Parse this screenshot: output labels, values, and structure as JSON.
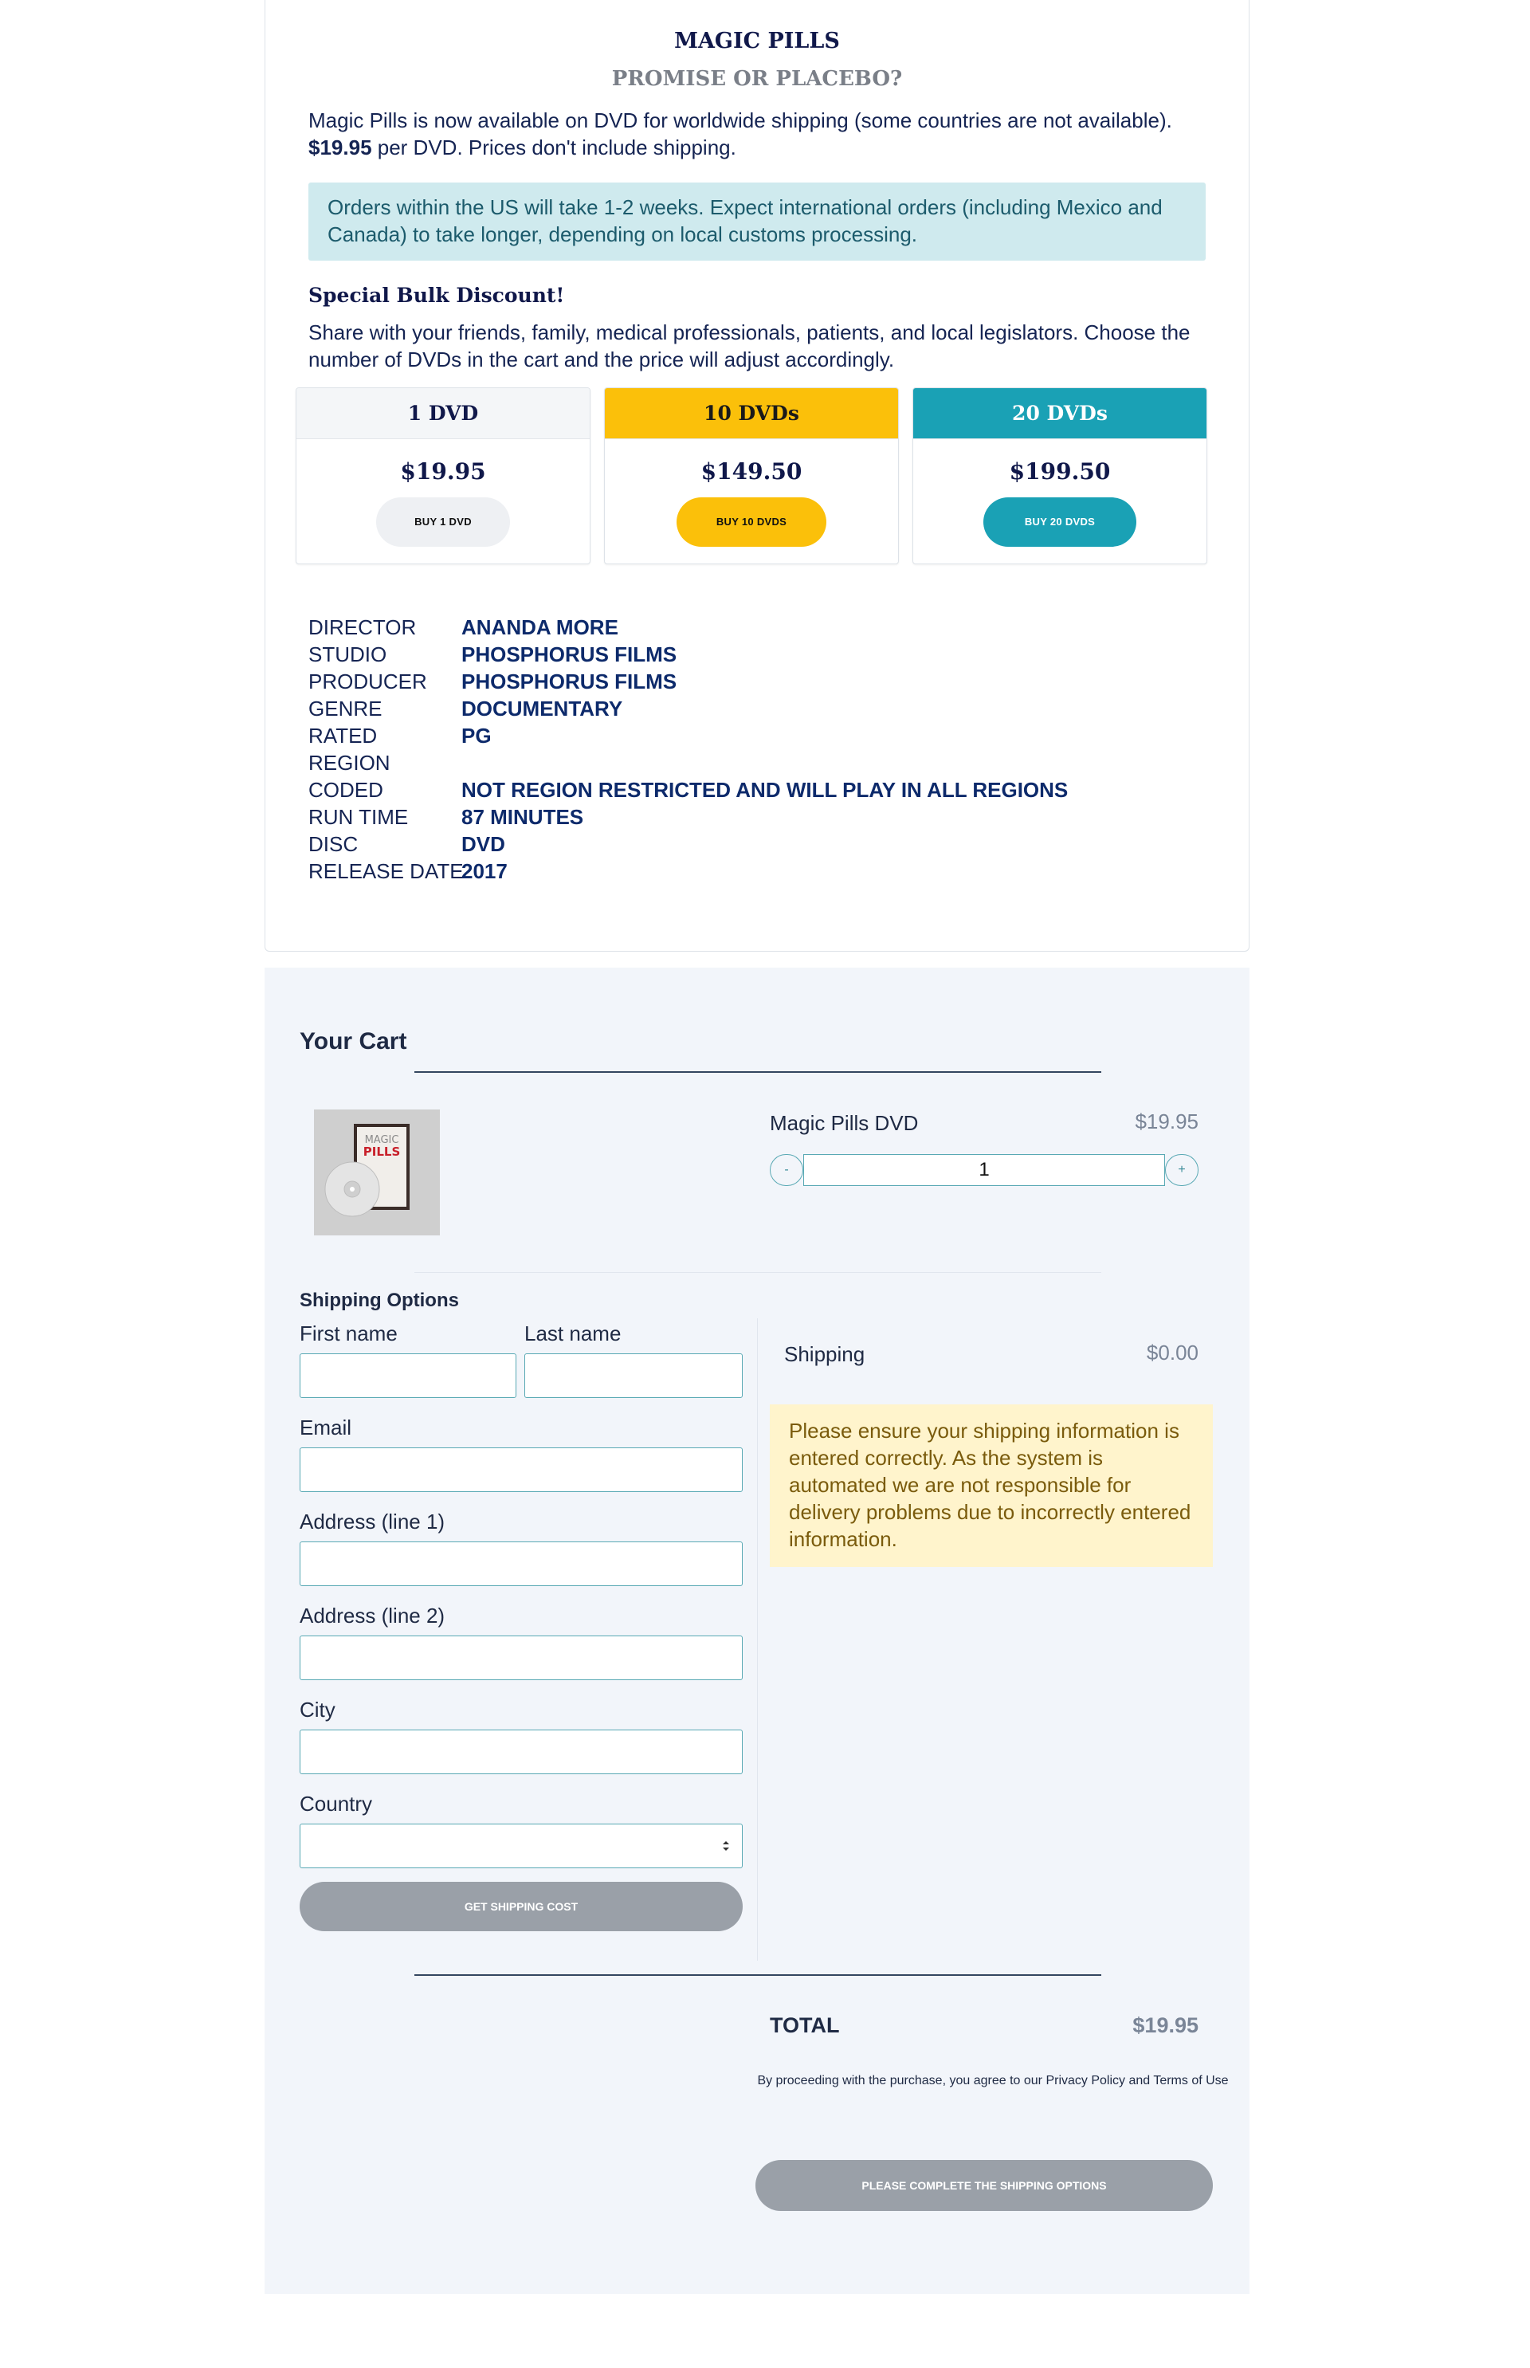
{
  "product": {
    "title": "MAGIC PILLS",
    "subtitle": "PROMISE OR PLACEBO?",
    "intro_line1": "Magic Pills is now available on DVD for worldwide shipping (some countries are not available).",
    "intro_price": "$19.95",
    "intro_line2_rest": " per DVD. Prices don't include shipping.",
    "notice": "Orders within the US will take 1-2 weeks. Expect international orders (including Mexico and Canada) to take longer, depending on local customs processing.",
    "bulk_title": "Special Bulk Discount!",
    "bulk_text": "Share with your friends, family, medical professionals, patients, and local legislators. Choose the number of DVDs in the cart and the price will adjust accordingly."
  },
  "pricing": [
    {
      "name": "1 DVD",
      "price": "$19.95",
      "button": "BUY 1 DVD",
      "head_bg": "#f4f6f8",
      "head_color": "#10184a",
      "btn_bg": "#eef0f3",
      "btn_color": "#111111"
    },
    {
      "name": "10 DVDs",
      "price": "$149.50",
      "button": "BUY 10 DVDS",
      "head_bg": "#fbc00a",
      "head_color": "#1a1a1a",
      "btn_bg": "#fbc00a",
      "btn_color": "#111111"
    },
    {
      "name": "20 DVDs",
      "price": "$199.50",
      "button": "BUY 20 DVDS",
      "head_bg": "#1aa1b5",
      "head_color": "#ffffff",
      "btn_bg": "#1aa1b5",
      "btn_color": "#ffffff"
    }
  ],
  "specs": [
    {
      "label": "DIRECTOR",
      "value": "ANANDA MORE"
    },
    {
      "label": "STUDIO",
      "value": "PHOSPHORUS FILMS"
    },
    {
      "label": "PRODUCER",
      "value": "PHOSPHORUS FILMS"
    },
    {
      "label": "GENRE",
      "value": "DOCUMENTARY"
    },
    {
      "label": "RATED",
      "value": "PG"
    },
    {
      "label": "REGION",
      "value": ""
    },
    {
      "label": "CODED",
      "value": "NOT REGION RESTRICTED AND WILL PLAY IN ALL REGIONS"
    },
    {
      "label": "RUN TIME",
      "value": "87 MINUTES"
    },
    {
      "label": "DISC",
      "value": "DVD"
    },
    {
      "label": "RELEASE DATE",
      "value": "2017"
    }
  ],
  "cart": {
    "title": "Your Cart",
    "item_name": "Magic Pills DVD",
    "item_price": "$19.95",
    "qty_minus": "-",
    "qty_plus": "+",
    "qty_value": "1",
    "thumb_text_top": "MAGIC",
    "thumb_text_mid": "PILLS"
  },
  "shipping": {
    "title": "Shipping Options",
    "first_name": "First name",
    "last_name": "Last name",
    "email": "Email",
    "address1": "Address (line 1)",
    "address2": "Address (line 2)",
    "city": "City",
    "country": "Country",
    "get_cost_button": "GET SHIPPING COST",
    "shipping_label": "Shipping",
    "shipping_value": "$0.00",
    "warning": "Please ensure your shipping information is entered correctly. As the system is automated we are not responsible for delivery problems due to incorrectly entered information."
  },
  "total": {
    "label": "TOTAL",
    "value": "$19.95",
    "terms": "By proceeding with the purchase, you agree to our Privacy Policy and Terms of Use",
    "complete_button": "PLEASE COMPLETE THE SHIPPING OPTIONS"
  }
}
